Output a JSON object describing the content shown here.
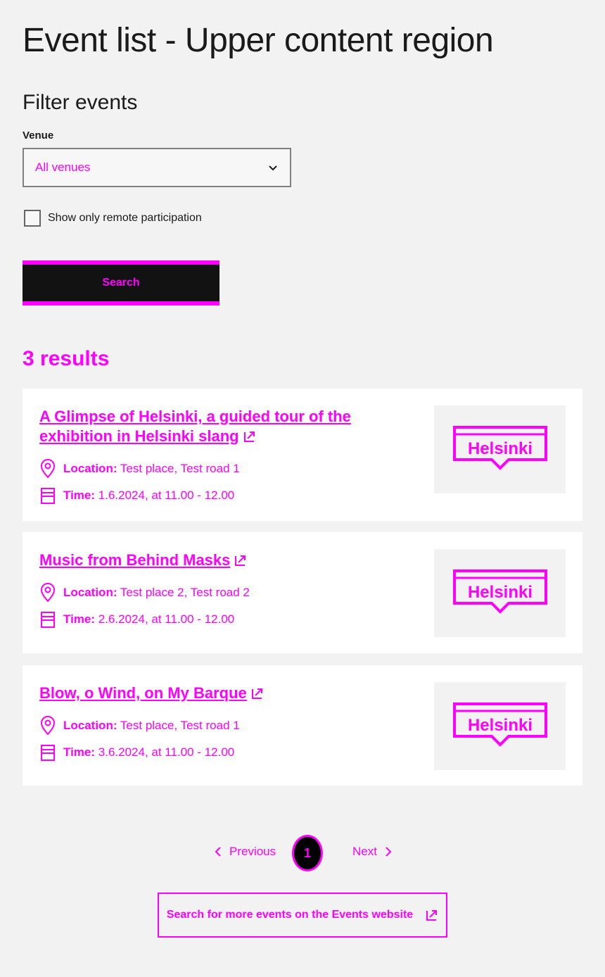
{
  "page": {
    "title": "Event list - Upper content region"
  },
  "filter": {
    "title": "Filter events",
    "venue_label": "Venue",
    "venue_value": "All venues",
    "remote_label": "Show only remote participation",
    "search_label": "Search"
  },
  "results": {
    "count_label": "3 results",
    "events": [
      {
        "title": "A Glimpse of Helsinki, a guided tour of the exhibition in Helsinki slang",
        "location_label": "Location:",
        "location": "Test place, Test road 1",
        "time_label": "Time:",
        "time": "1.6.2024, at 11.00 - 12.00",
        "image_text": "Helsinki"
      },
      {
        "title": "Music from Behind Masks",
        "location_label": "Location:",
        "location": "Test place 2, Test road 2",
        "time_label": "Time:",
        "time": "2.6.2024, at 11.00 - 12.00",
        "image_text": "Helsinki"
      },
      {
        "title": "Blow, o Wind, on My Barque",
        "location_label": "Location:",
        "location": "Test place, Test road 1",
        "time_label": "Time:",
        "time": "3.6.2024, at 11.00 - 12.00",
        "image_text": "Helsinki"
      }
    ]
  },
  "pagination": {
    "previous": "Previous",
    "current": "1",
    "next": "Next"
  },
  "more": {
    "label": "Search for more events on the Events website"
  },
  "colors": {
    "accent": "#ff00ff",
    "button_bg": "#121212",
    "card_bg": "#ffffff",
    "page_bg": "#f2f2f2"
  },
  "icons": [
    "chevron-down-icon",
    "location-pin-icon",
    "calendar-icon",
    "external-link-icon",
    "chevron-left-icon",
    "chevron-right-icon"
  ]
}
